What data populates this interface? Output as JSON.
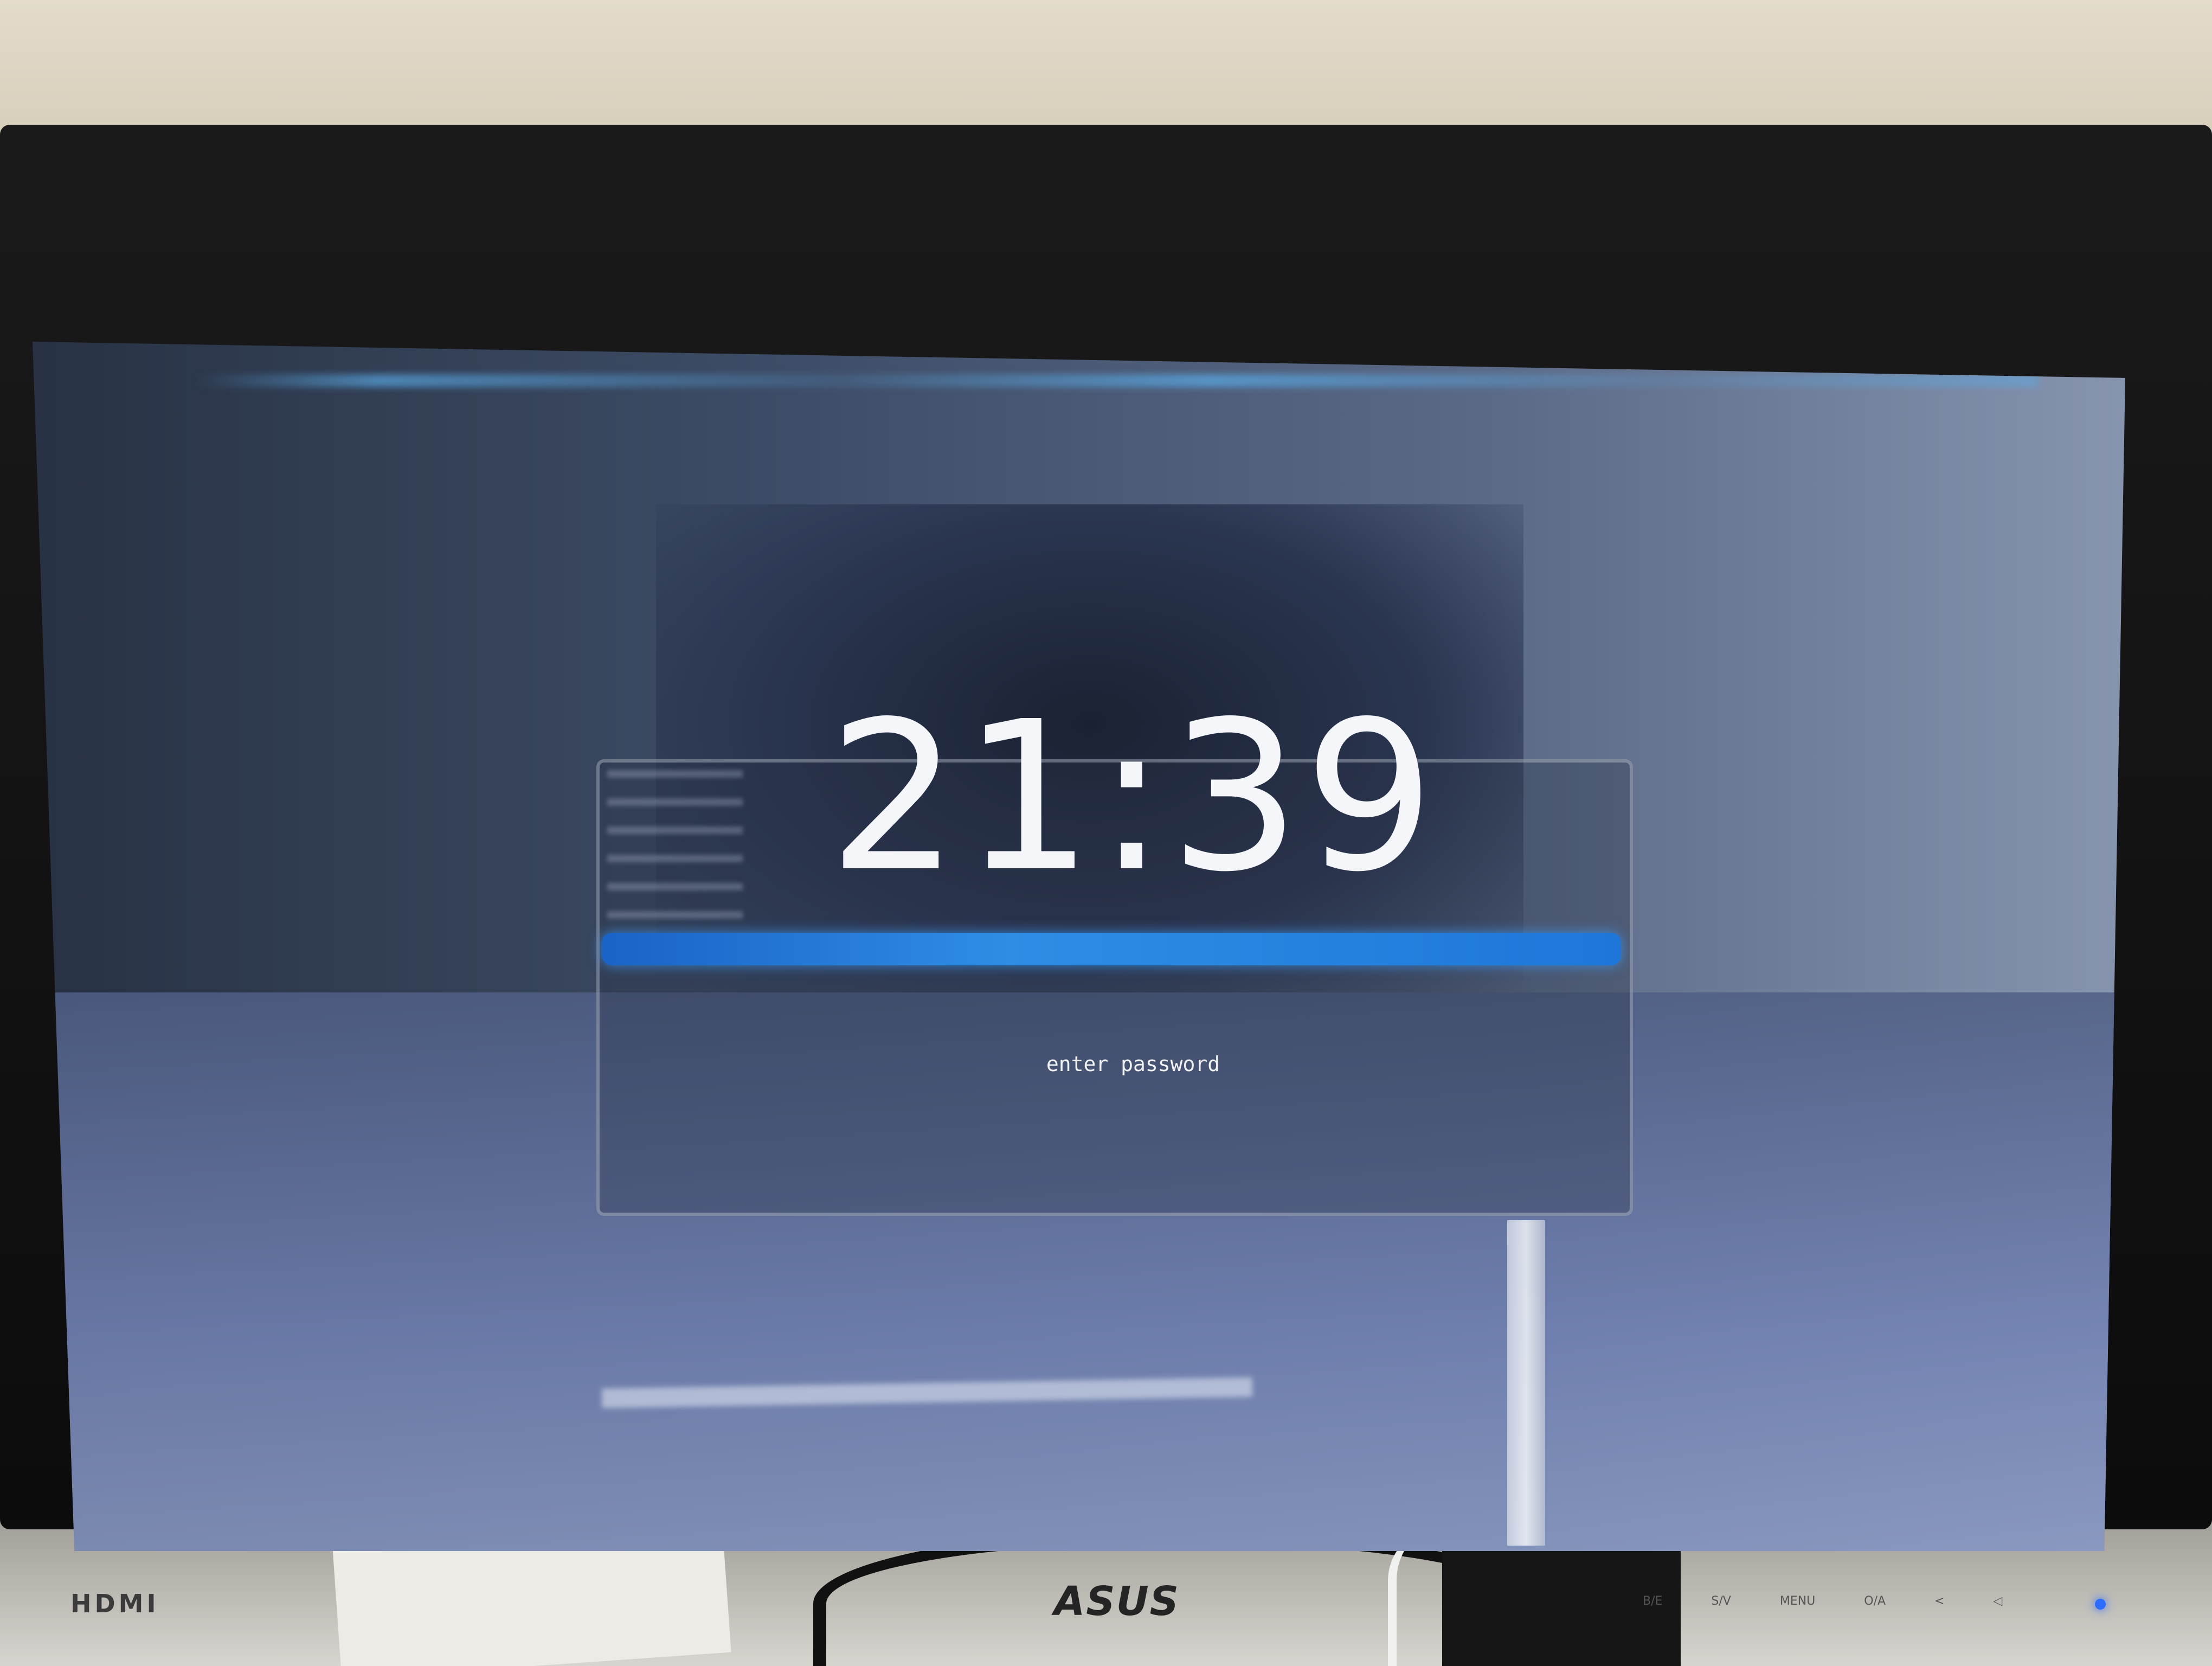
{
  "lock_screen": {
    "time": "21:39",
    "prompt": "enter password"
  },
  "monitor": {
    "port_label": "HDMI",
    "brand": "ASUS",
    "buttons": [
      "B/E",
      "S/V",
      "MENU",
      "O/A",
      "<",
      "◁"
    ]
  },
  "colors": {
    "accent_bar": "#2f8de4",
    "power_led": "#2b6cff"
  }
}
